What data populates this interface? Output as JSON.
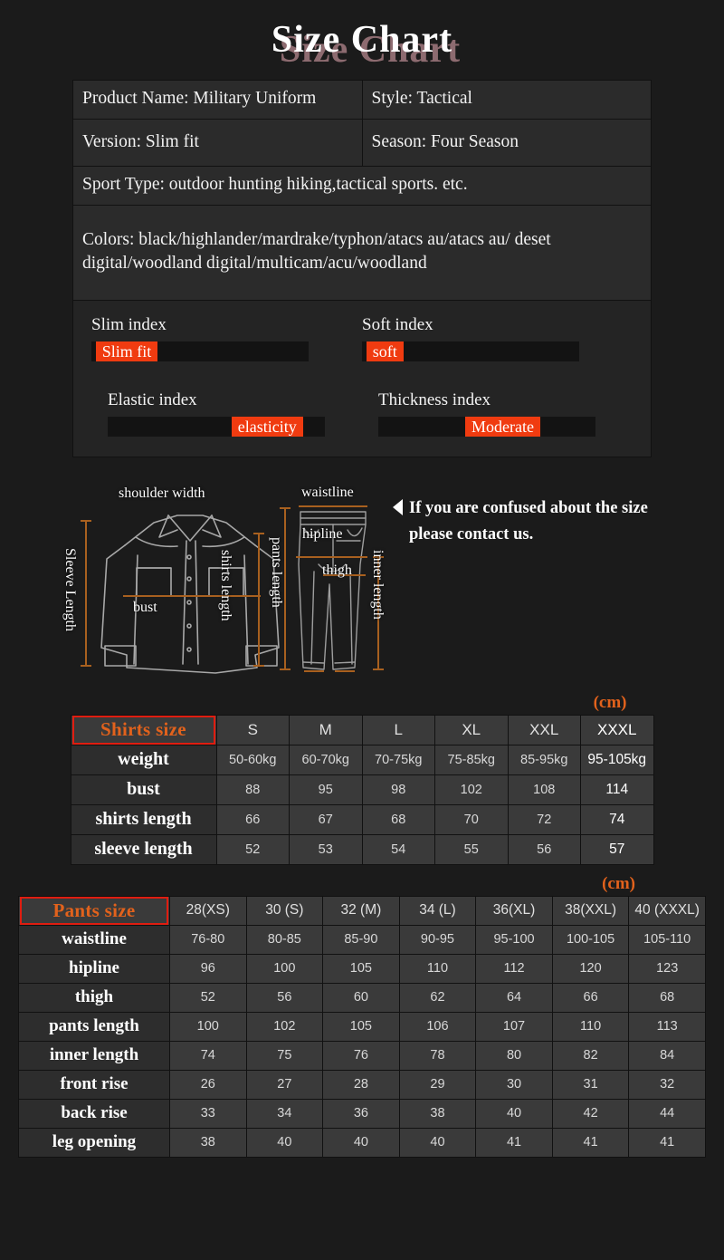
{
  "title": "Size Chart",
  "info": {
    "product_name": "Product Name: Military Uniform",
    "style": "Style: Tactical",
    "version": "Version: Slim fit",
    "season": "Season: Four Season",
    "sport_type": "Sport Type: outdoor hunting hiking,tactical sports. etc.",
    "colors": "Colors: black/highlander/mardrake/typhon/atacs au/atacs au/ deset digital/woodland digital/multicam/acu/woodland"
  },
  "indices": [
    {
      "label": "Slim index",
      "value": "Slim fit",
      "offset_pct": 2
    },
    {
      "label": "Soft index",
      "value": "soft",
      "offset_pct": 2
    },
    {
      "label": "Elastic index",
      "value": "elasticity",
      "offset_pct": 57
    },
    {
      "label": "Thickness index",
      "value": "Moderate",
      "offset_pct": 40
    }
  ],
  "diagram": {
    "shoulder_width": "shoulder width",
    "sleeve_length": "Sleeve Length",
    "bust": "bust",
    "shirts_length": "shirts length",
    "waistline": "waistline",
    "hipline": "hipline",
    "thigh": "thigh",
    "pants_length": "pants length",
    "inner_length": "inner length"
  },
  "contact": {
    "line1": "If you are confused about the size",
    "line2": "please contact us."
  },
  "shirts_table": {
    "unit": "(cm)",
    "corner": "Shirts size",
    "columns": [
      "S",
      "M",
      "L",
      "XL",
      "XXL",
      "XXXL"
    ],
    "rows": [
      {
        "label": "weight",
        "values": [
          "50-60kg",
          "60-70kg",
          "70-75kg",
          "75-85kg",
          "85-95kg",
          "95-105kg"
        ]
      },
      {
        "label": "bust",
        "values": [
          "88",
          "95",
          "98",
          "102",
          "108",
          "114"
        ]
      },
      {
        "label": "shirts length",
        "values": [
          "66",
          "67",
          "68",
          "70",
          "72",
          "74"
        ]
      },
      {
        "label": "sleeve length",
        "values": [
          "52",
          "53",
          "54",
          "55",
          "56",
          "57"
        ]
      }
    ]
  },
  "pants_table": {
    "unit": "(cm)",
    "corner": "Pants size",
    "columns": [
      "28(XS)",
      "30 (S)",
      "32 (M)",
      "34 (L)",
      "36(XL)",
      "38(XXL)",
      "40 (XXXL)"
    ],
    "rows": [
      {
        "label": "waistline",
        "values": [
          "76-80",
          "80-85",
          "85-90",
          "90-95",
          "95-100",
          "100-105",
          "105-110"
        ]
      },
      {
        "label": "hipline",
        "values": [
          "96",
          "100",
          "105",
          "110",
          "112",
          "120",
          "123"
        ]
      },
      {
        "label": "thigh",
        "values": [
          "52",
          "56",
          "60",
          "62",
          "64",
          "66",
          "68"
        ]
      },
      {
        "label": "pants length",
        "values": [
          "100",
          "102",
          "105",
          "106",
          "107",
          "110",
          "113"
        ]
      },
      {
        "label": "inner length",
        "values": [
          "74",
          "75",
          "76",
          "78",
          "80",
          "82",
          "84"
        ]
      },
      {
        "label": "front rise",
        "values": [
          "26",
          "27",
          "28",
          "29",
          "30",
          "31",
          "32"
        ]
      },
      {
        "label": "back rise",
        "values": [
          "33",
          "34",
          "36",
          "38",
          "40",
          "42",
          "44"
        ]
      },
      {
        "label": "leg opening",
        "values": [
          "38",
          "40",
          "40",
          "40",
          "41",
          "41",
          "41"
        ]
      }
    ]
  },
  "colors": {
    "background": "#1b1b1b",
    "accent_orange": "#f03b10",
    "label_orange": "#e2621c",
    "box_red": "#e01d10",
    "title_shadow": "#8d6b70"
  }
}
